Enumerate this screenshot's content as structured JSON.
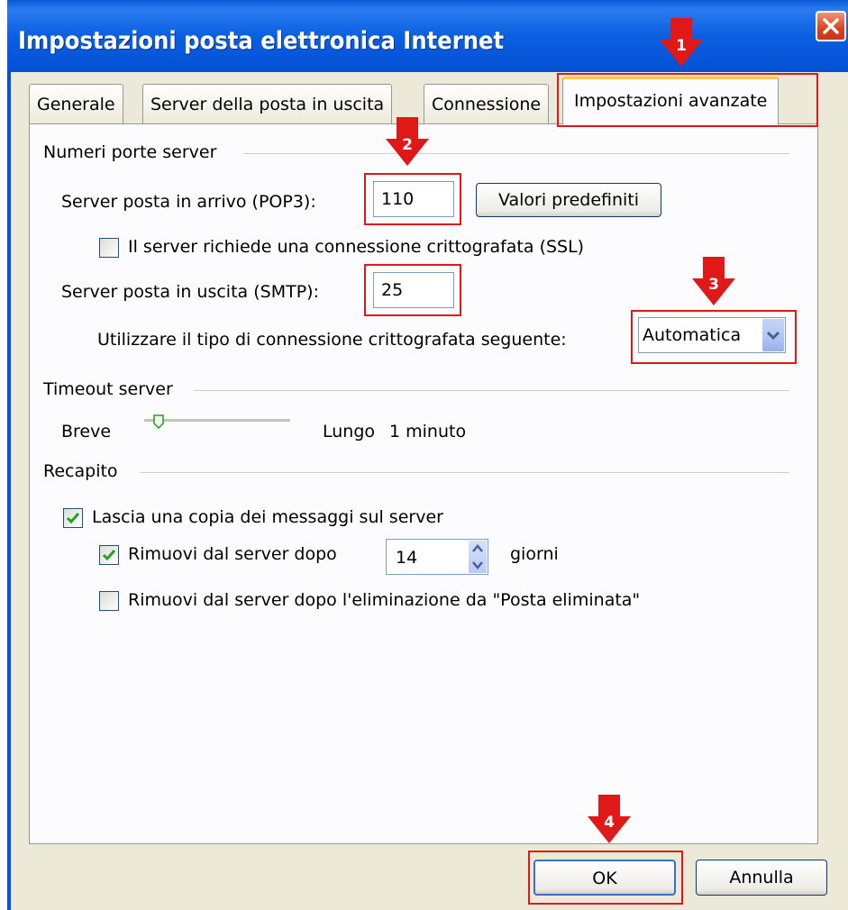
{
  "window": {
    "title": "Impostazioni posta elettronica Internet"
  },
  "tabs": [
    {
      "label": "Generale",
      "active": false
    },
    {
      "label": "Server della posta in uscita",
      "active": false
    },
    {
      "label": "Connessione",
      "active": false
    },
    {
      "label": "Impostazioni avanzate",
      "active": true
    }
  ],
  "ports": {
    "group_label": "Numeri porte server",
    "incoming_label": "Server posta in arrivo (POP3):",
    "incoming_value": "110",
    "defaults_button": "Valori predefiniti",
    "ssl_label": "Il server richiede una connessione crittografata (SSL)",
    "ssl_checked": false,
    "outgoing_label": "Server posta in uscita (SMTP):",
    "outgoing_value": "25",
    "encryption_label": "Utilizzare il tipo di connessione crittografata seguente:",
    "encryption_value": "Automatica"
  },
  "timeout": {
    "group_label": "Timeout server",
    "short_label": "Breve",
    "long_label": "Lungo",
    "value_text": "1 minuto",
    "slider_fraction": 0.1
  },
  "delivery": {
    "group_label": "Recapito",
    "leave_copy_label": "Lascia una copia dei messaggi sul server",
    "leave_copy_checked": true,
    "remove_after_label": "Rimuovi dal server dopo",
    "remove_after_checked": true,
    "remove_after_days": "14",
    "days_unit": "giorni",
    "remove_deleted_label": "Rimuovi dal server dopo l'eliminazione da \"Posta eliminata\"",
    "remove_deleted_checked": false
  },
  "buttons": {
    "ok": "OK",
    "cancel": "Annulla"
  },
  "annotations": {
    "color": "#e01818",
    "markers": [
      "1",
      "2",
      "3",
      "4"
    ]
  },
  "colors": {
    "titlebar": "#0a5fe0",
    "dialog_bg": "#ece9d8",
    "panel_bg": "#fcfcfe",
    "active_tab_accent": "#ffc83c",
    "close_button": "#d8431c",
    "check_mark": "#21a121"
  },
  "icons": {
    "close": "close-icon",
    "dropdown": "chevron-down-icon",
    "spinner_up": "arrow-up-icon",
    "spinner_down": "arrow-down-icon",
    "checkbox": "check-icon",
    "marker": "down-arrow-marker-icon"
  }
}
